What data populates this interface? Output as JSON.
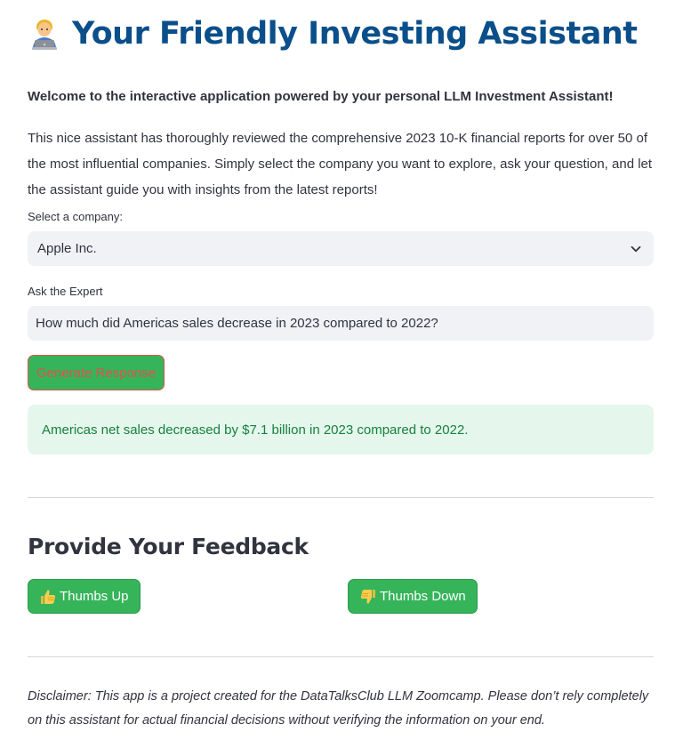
{
  "header": {
    "title": "Your Friendly Investing Assistant",
    "emoji_icon": "person-at-laptop-emoji"
  },
  "welcome_text": "Welcome to the interactive application powered by your personal LLM Investment Assistant!",
  "intro_text": "This nice assistant has thoroughly reviewed the comprehensive 2023 10-K financial reports for over 50 of the most influential companies. Simply select the company you want to explore, ask your question, and let the assistant guide you with insights from the latest reports!",
  "company_select": {
    "label": "Select a company:",
    "selected": "Apple Inc."
  },
  "question": {
    "label": "Ask the Expert",
    "value": "How much did Americas sales decrease in 2023 compared to 2022?"
  },
  "generate_button": {
    "label": "Generate Response"
  },
  "response": {
    "text": "Americas net sales decreased by $7.1 billion in 2023 compared to 2022."
  },
  "feedback": {
    "title": "Provide Your Feedback",
    "thumbs_up_label": "Thumbs Up",
    "thumbs_down_label": "Thumbs Down"
  },
  "disclaimer": "Disclaimer: This app is a project created for the DataTalksClub LLM Zoomcamp. Please don’t rely completely on this assistant for actual financial decisions without verifying the information on your end.",
  "colors": {
    "title": "#0b4f8a",
    "button_green": "#36b45a",
    "button_text_red": "#e0524b",
    "success_bg": "#e5f7ec",
    "success_text": "#17803d",
    "input_bg": "#f0f2f6"
  }
}
